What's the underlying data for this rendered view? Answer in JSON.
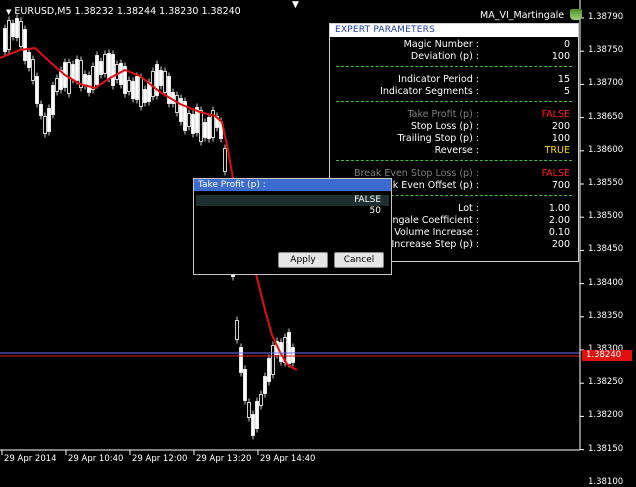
{
  "chart": {
    "symbol_title": "EURUSD,M5  1.38232 1.38244 1.38230 1.38240",
    "ea_name": "MA_VI_Martingale",
    "current_price": "1.38240",
    "price_labels": [
      "1.38790",
      "1.38750",
      "1.38700",
      "1.38650",
      "1.38600",
      "1.38550",
      "1.38500",
      "1.38450",
      "1.38400",
      "1.38350",
      "1.38300",
      "1.38250",
      "1.38200",
      "1.38150",
      "1.38100"
    ],
    "time_labels": [
      "29 Apr 2014",
      "29 Apr 10:40",
      "29 Apr 12:00",
      "29 Apr 13:20",
      "29 Apr 14:40"
    ],
    "colors": {
      "background": "#000000",
      "candles": "#ffffff",
      "ma_line": "#e01010",
      "bid_line": "#e02020",
      "ask_line": "#6f6fff"
    }
  },
  "panel": {
    "title": "EXPERT  PARAMETERS",
    "groups": [
      [
        {
          "label": "Magic Number :",
          "value": "0"
        },
        {
          "label": "Deviation (p) :",
          "value": "100"
        }
      ],
      [
        {
          "label": "Indicator Period :",
          "value": "15"
        },
        {
          "label": "Indicator Segments :",
          "value": "5"
        }
      ],
      [
        {
          "label": "Take Profit (p) :",
          "value": "FALSE",
          "disabled": true,
          "color": "red"
        },
        {
          "label": "Stop Loss (p) :",
          "value": "200"
        },
        {
          "label": "Trailing Stop (p) :",
          "value": "100"
        },
        {
          "label": "Reverse :",
          "value": "TRUE",
          "color": "yellow"
        }
      ],
      [
        {
          "label": "Break Even Stop Loss (p) :",
          "value": "FALSE",
          "disabled": true,
          "color": "red"
        },
        {
          "label": "Break Even Offset (p) :",
          "value": "700"
        }
      ],
      [
        {
          "label": "Lot :",
          "value": "1.00"
        },
        {
          "label": "Martingale Coefficient :",
          "value": "2.00"
        },
        {
          "label": "Volume Increase :",
          "value": "0.10"
        },
        {
          "label": "Volume Increase Step (p) :",
          "value": "200"
        }
      ]
    ]
  },
  "dialog": {
    "title": "Take Profit (p) :",
    "options": [
      "FALSE",
      "50"
    ],
    "selected_index": 0,
    "apply_label": "Apply",
    "cancel_label": "Cancel"
  }
}
